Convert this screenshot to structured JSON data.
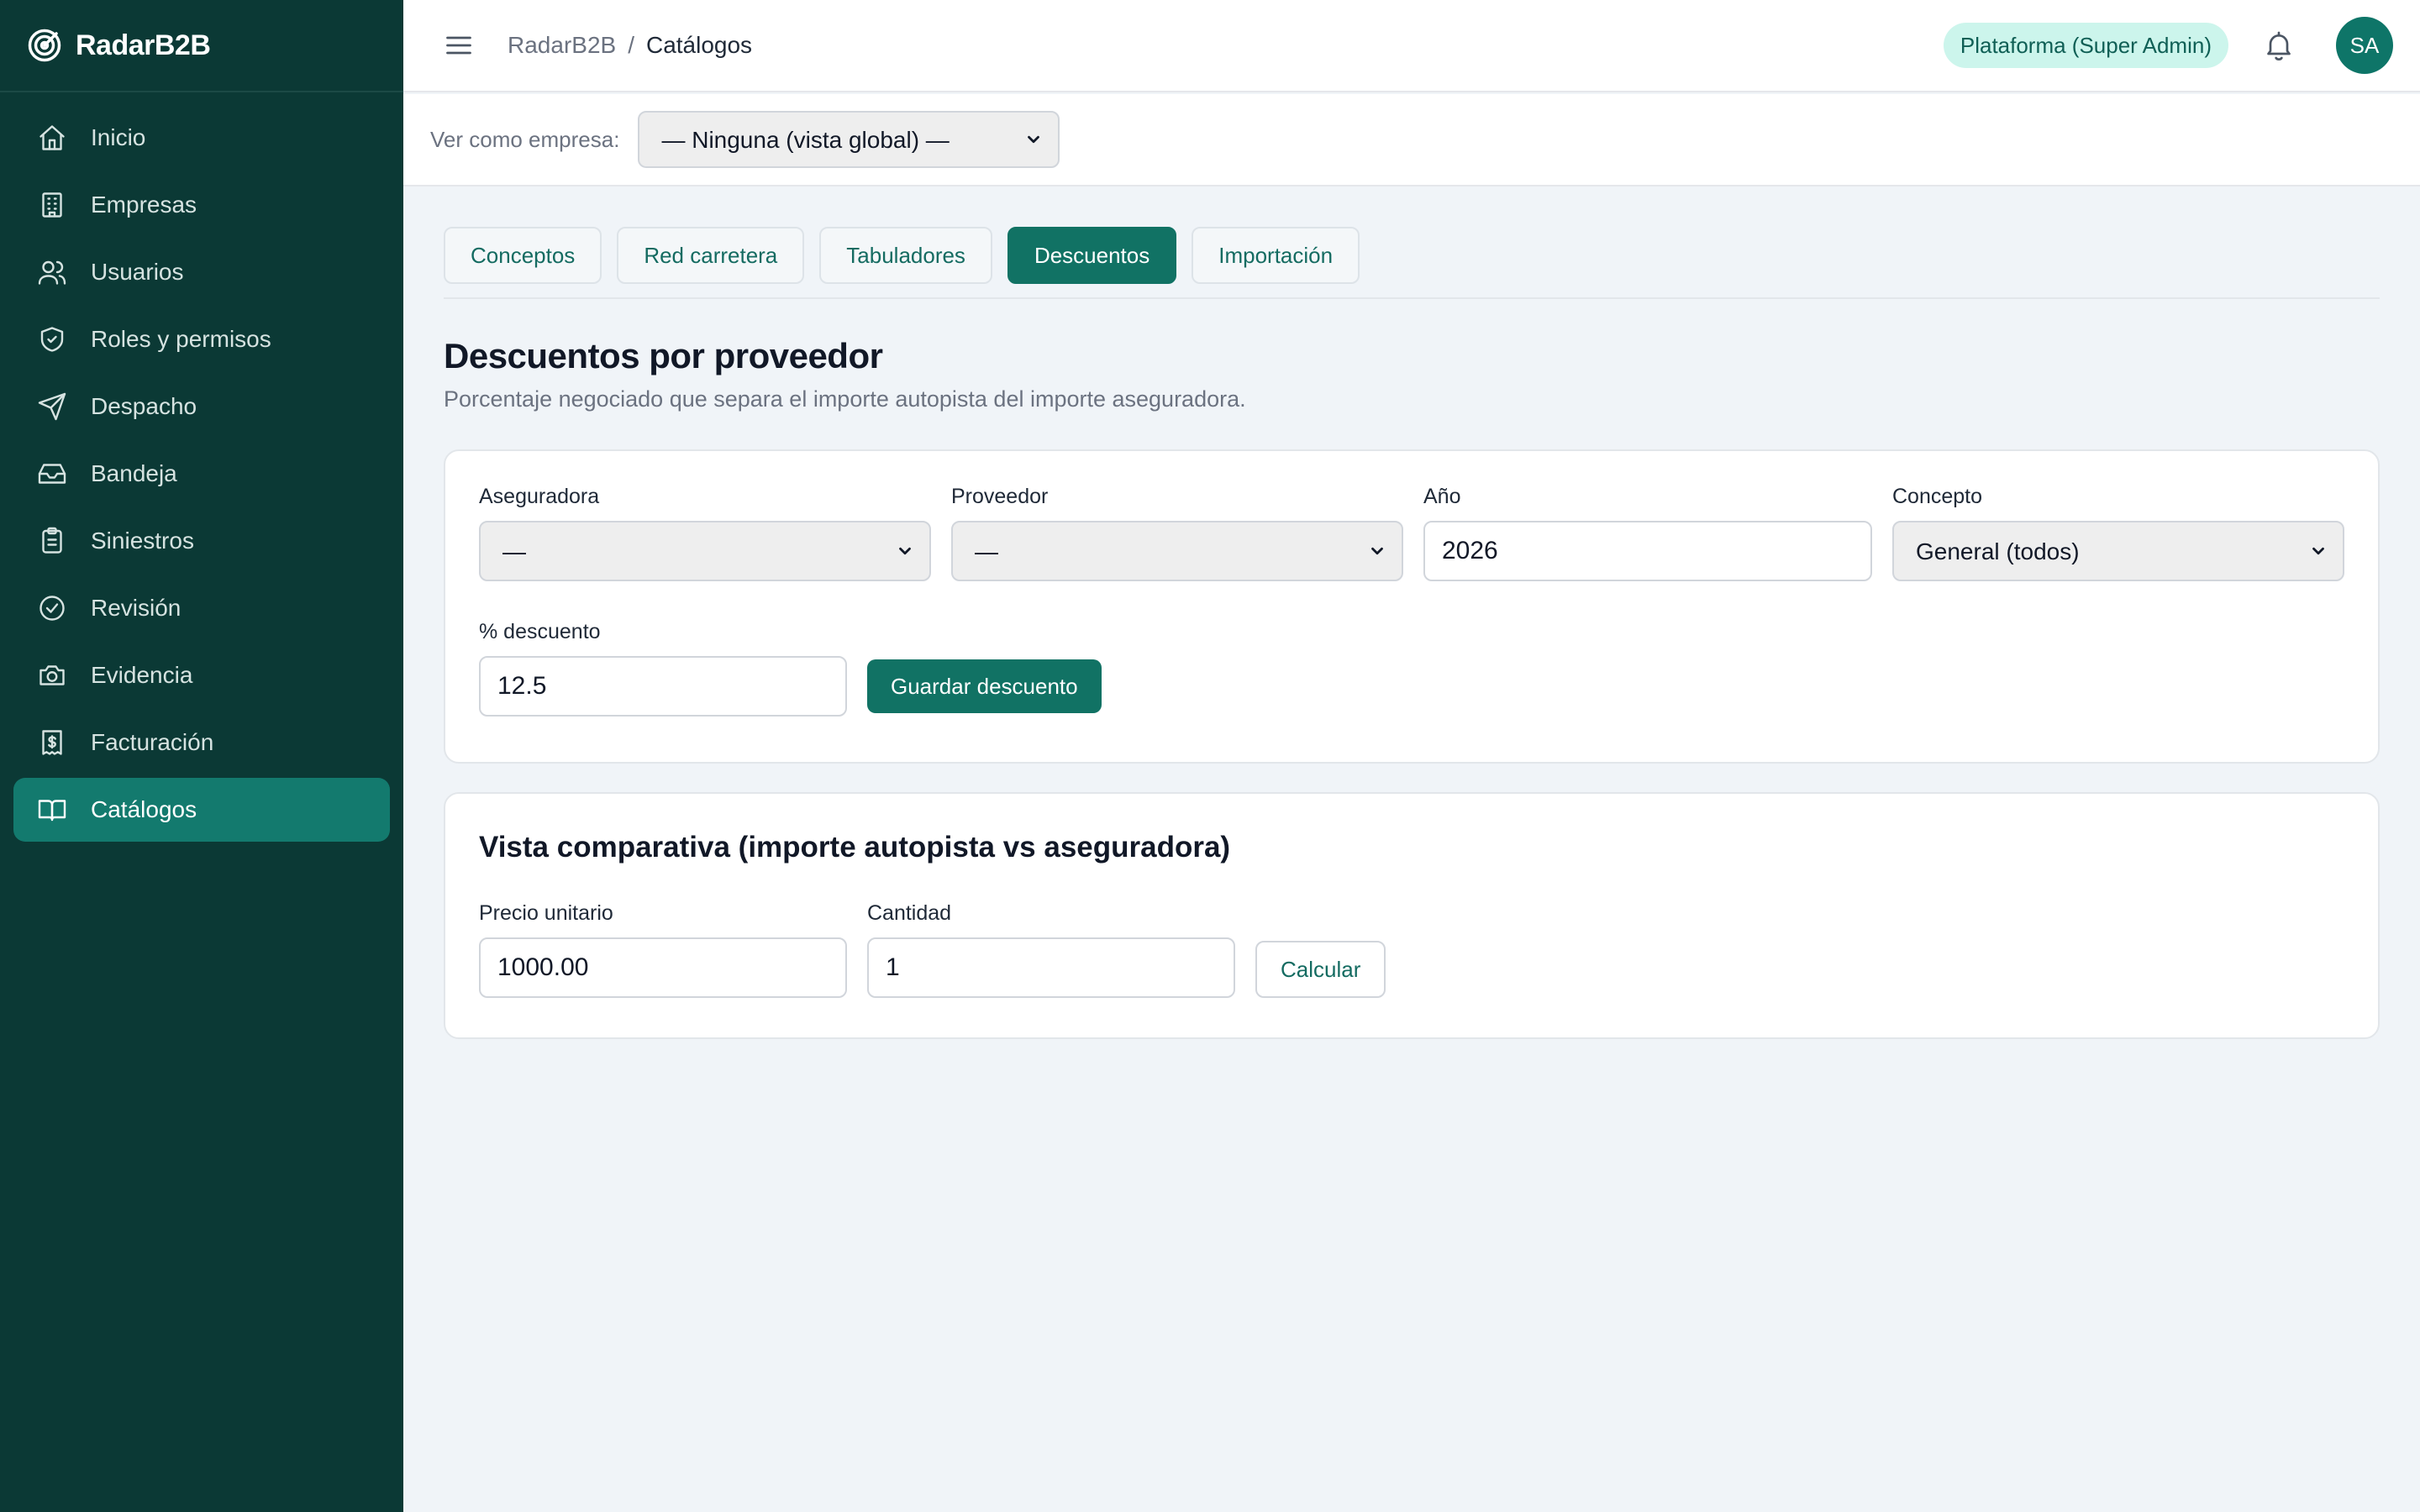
{
  "brand": {
    "name": "RadarB2B"
  },
  "sidebar": {
    "items": [
      {
        "label": "Inicio",
        "icon": "home-icon"
      },
      {
        "label": "Empresas",
        "icon": "building-icon"
      },
      {
        "label": "Usuarios",
        "icon": "users-icon"
      },
      {
        "label": "Roles y permisos",
        "icon": "shield-check-icon"
      },
      {
        "label": "Despacho",
        "icon": "send-icon"
      },
      {
        "label": "Bandeja",
        "icon": "inbox-icon"
      },
      {
        "label": "Siniestros",
        "icon": "clipboard-icon"
      },
      {
        "label": "Revisión",
        "icon": "check-circle-icon"
      },
      {
        "label": "Evidencia",
        "icon": "camera-icon"
      },
      {
        "label": "Facturación",
        "icon": "receipt-icon"
      },
      {
        "label": "Catálogos",
        "icon": "book-open-icon",
        "active": true
      }
    ]
  },
  "header": {
    "breadcrumb": {
      "root": "RadarB2B",
      "separator": "/",
      "current": "Catálogos"
    },
    "role_badge": "Plataforma (Super Admin)",
    "avatar_initials": "SA"
  },
  "company_bar": {
    "label": "Ver como empresa:",
    "selected": "— Ninguna (vista global) —"
  },
  "tabs": [
    {
      "label": "Conceptos"
    },
    {
      "label": "Red carretera"
    },
    {
      "label": "Tabuladores"
    },
    {
      "label": "Descuentos",
      "active": true
    },
    {
      "label": "Importación"
    }
  ],
  "page": {
    "title": "Descuentos por proveedor",
    "subtitle": "Porcentaje negociado que separa el importe autopista del importe aseguradora."
  },
  "discount_form": {
    "aseguradora": {
      "label": "Aseguradora",
      "selected": "—"
    },
    "proveedor": {
      "label": "Proveedor",
      "selected": "—"
    },
    "anio": {
      "label": "Año",
      "value": "2026"
    },
    "concepto": {
      "label": "Concepto",
      "selected": "General (todos)"
    },
    "descuento": {
      "label": "% descuento",
      "value": "12.5"
    },
    "save_label": "Guardar descuento"
  },
  "comparison": {
    "title": "Vista comparativa (importe autopista vs aseguradora)",
    "precio": {
      "label": "Precio unitario",
      "value": "1000.00"
    },
    "cantidad": {
      "label": "Cantidad",
      "value": "1"
    },
    "calc_label": "Calcular"
  },
  "colors": {
    "sidebar_bg": "#0b3935",
    "accent": "#117264",
    "badge_bg": "#ccf5ec",
    "page_bg": "#f0f4f8"
  }
}
